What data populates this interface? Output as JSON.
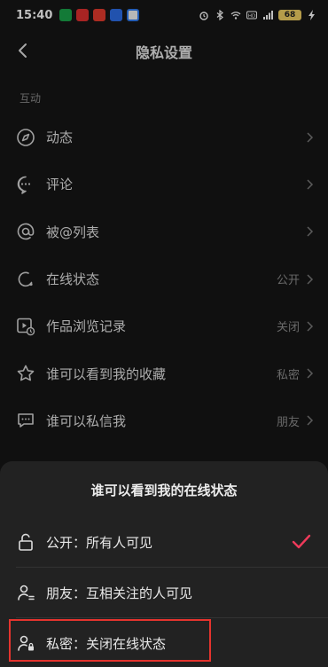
{
  "status_bar": {
    "time": "15:40",
    "battery": "68"
  },
  "header": {
    "title": "隐私设置"
  },
  "section": {
    "label": "互动"
  },
  "items": [
    {
      "label": "动态",
      "value": "",
      "icon": "compass-icon"
    },
    {
      "label": "评论",
      "value": "",
      "icon": "comment-icon"
    },
    {
      "label": "被@列表",
      "value": "",
      "icon": "at-icon"
    },
    {
      "label": "在线状态",
      "value": "公开",
      "icon": "online-status-icon"
    },
    {
      "label": "作品浏览记录",
      "value": "关闭",
      "icon": "view-history-icon"
    },
    {
      "label": "谁可以看到我的收藏",
      "value": "私密",
      "icon": "star-icon"
    },
    {
      "label": "谁可以私信我",
      "value": "朋友",
      "icon": "message-icon"
    }
  ],
  "sheet": {
    "title": "谁可以看到我的在线状态",
    "options": [
      {
        "label": "公开：所有人可见",
        "selected": true,
        "icon": "unlock-icon"
      },
      {
        "label": "朋友：互相关注的人可见",
        "selected": false,
        "icon": "friends-icon"
      },
      {
        "label": "私密：关闭在线状态",
        "selected": false,
        "icon": "private-user-icon"
      }
    ]
  },
  "colors": {
    "background": "#161616",
    "sheet": "#222222",
    "accent": "#ee3a5a",
    "highlight_box": "#e5342e"
  }
}
